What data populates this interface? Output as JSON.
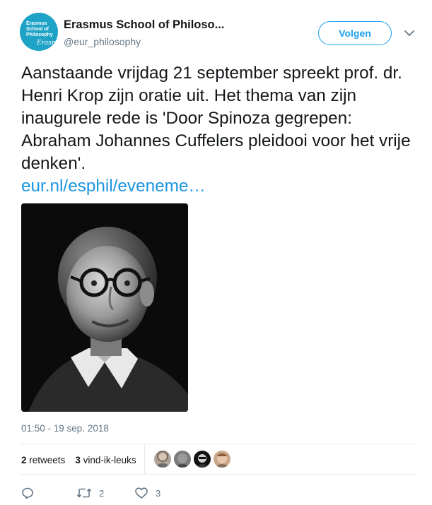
{
  "account": {
    "display_name": "Erasmus School of Philoso...",
    "handle": "@eur_philosophy",
    "avatar_text": [
      "Erasmus",
      "School of",
      "Philosophy"
    ],
    "avatar_color": "#1ea3c7"
  },
  "follow_button": {
    "label": "Volgen"
  },
  "tweet": {
    "text": "Aanstaande vrijdag 21 september spreekt prof. dr. Henri Krop zijn oratie uit. Het thema van zijn inaugurele rede is 'Door Spinoza gegrepen: Abraham Johannes Cuffelers pleidooi voor het vrije denken'.",
    "link": "eur.nl/esphil/eveneme…",
    "timestamp": "01:50 - 19 sep. 2018"
  },
  "stats": {
    "retweets_count": "2",
    "retweets_label": "retweets",
    "likes_count": "3",
    "likes_label": "vind-ik-leuks"
  },
  "actions": {
    "reply_icon": "reply-icon",
    "retweet_icon": "retweet-icon",
    "retweet_count": "2",
    "like_icon": "heart-icon",
    "like_count": "3"
  },
  "colors": {
    "accent": "#1da1f2",
    "link": "#1b95e0",
    "muted": "#657786",
    "divider": "#e6ecf0"
  }
}
